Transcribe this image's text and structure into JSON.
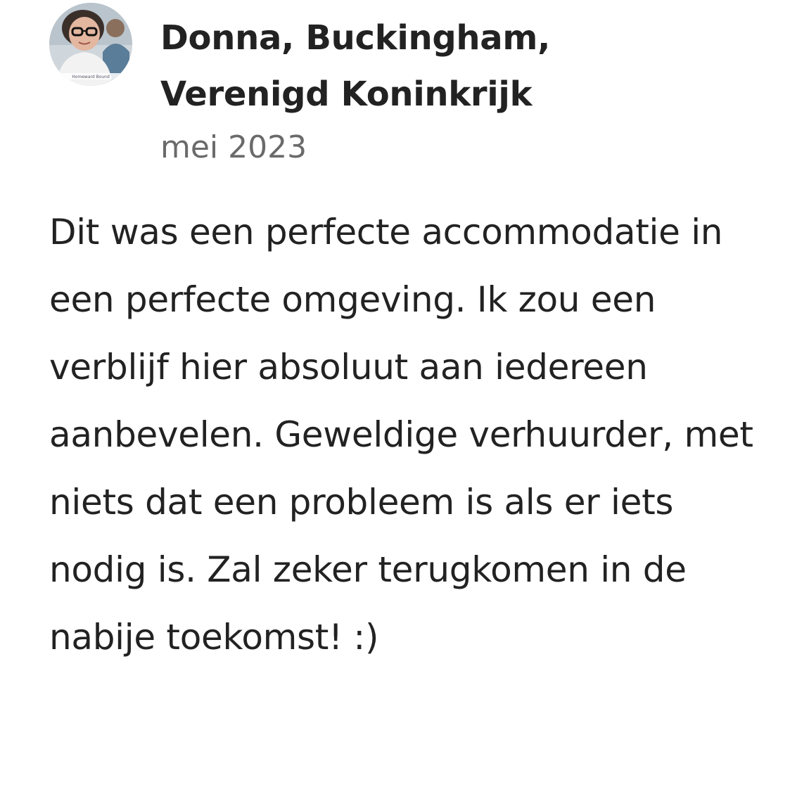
{
  "review": {
    "author": {
      "name_line1": "Donna, Buckingham,",
      "name_line2": "Verenigd Koninkrijk",
      "avatar_icon": "user-avatar-photo",
      "avatar_caption": "Homeward Bound"
    },
    "date": "mei 2023",
    "text": "Dit was een perfecte accommodatie in een perfecte omgeving. Ik zou een verblijf hier absoluut aan iedereen aanbevelen. Geweldige verhuurder, met niets dat een probleem is als er iets nodig is. Zal zeker terugkomen in de nabije toekomst! :)"
  },
  "colors": {
    "primary_text": "#222222",
    "secondary_text": "#6a6a6a",
    "background": "#ffffff"
  }
}
